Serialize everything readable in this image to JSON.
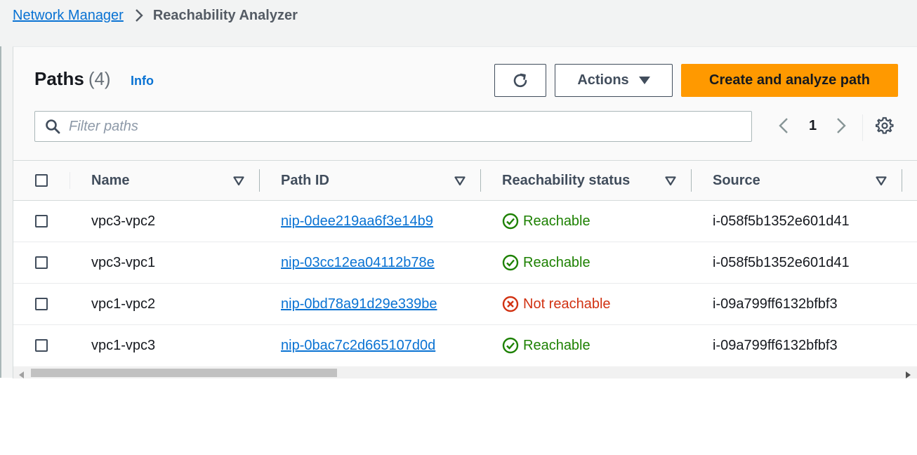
{
  "breadcrumb": {
    "parent": "Network Manager",
    "current": "Reachability Analyzer"
  },
  "panel": {
    "title": "Paths",
    "count": "(4)",
    "info": "Info",
    "actions_label": "Actions",
    "primary_label": "Create and analyze path"
  },
  "filter": {
    "placeholder": "Filter paths",
    "value": ""
  },
  "pagination": {
    "current_page": "1"
  },
  "table": {
    "columns": [
      "Name",
      "Path ID",
      "Reachability status",
      "Source"
    ],
    "rows": [
      {
        "name": "vpc3-vpc2",
        "path_id": "nip-0dee219aa6f3e14b9",
        "status": "Reachable",
        "status_type": "success",
        "source": "i-058f5b1352e601d41"
      },
      {
        "name": "vpc3-vpc1",
        "path_id": "nip-03cc12ea04112b78e",
        "status": "Reachable",
        "status_type": "success",
        "source": "i-058f5b1352e601d41"
      },
      {
        "name": "vpc1-vpc2",
        "path_id": "nip-0bd78a91d29e339be",
        "status": "Not reachable",
        "status_type": "error",
        "source": "i-09a799ff6132bfbf3"
      },
      {
        "name": "vpc1-vpc3",
        "path_id": "nip-0bac7c2d665107d0d",
        "status": "Reachable",
        "status_type": "success",
        "source": "i-09a799ff6132bfbf3"
      }
    ]
  },
  "colors": {
    "link": "#0972d3",
    "primary": "#ff9900",
    "success": "#1d8102",
    "error": "#d13212"
  },
  "icons": {
    "breadcrumb_separator": "chevron-right-icon",
    "refresh": "refresh-icon",
    "actions_caret": "caret-down-icon",
    "search": "search-icon",
    "prev": "chevron-left-icon",
    "next": "chevron-right-icon",
    "settings": "gear-icon",
    "sort": "sort-caret-icon",
    "success": "status-success-icon",
    "error": "status-error-icon"
  }
}
